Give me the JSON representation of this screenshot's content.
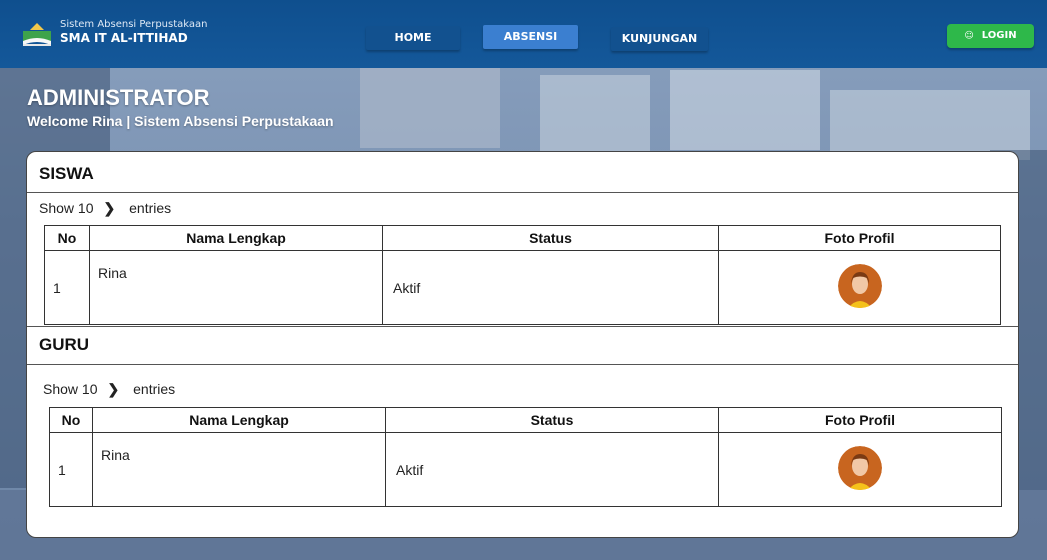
{
  "header": {
    "brand_sub": "Sistem Absensi Perpustakaan",
    "brand_main": "SMA IT AL-ITTIHAD",
    "nav": {
      "home": "HOME",
      "absensi": "ABSENSI",
      "kunjungan": "KUNJUNGAN"
    },
    "login": "LOGIN"
  },
  "page": {
    "title": "ADMINISTRATOR",
    "subtitle": "Welcome Rina | Sistem Absensi Perpustakaan"
  },
  "siswa": {
    "title": "SISWA",
    "show_label": "Show",
    "show_value": "10",
    "entries_label": "entries",
    "columns": [
      "No",
      "Nama Lengkap",
      "Status",
      "Foto Profil"
    ],
    "rows": [
      {
        "no": "1",
        "nama": "Rina",
        "status": "Aktif"
      }
    ]
  },
  "guru": {
    "title": "GURU",
    "show_label": "Show",
    "show_value": "10",
    "entries_label": "entries",
    "columns": [
      "No",
      "Nama Lengkap",
      "Status",
      "Foto Profil"
    ],
    "rows": [
      {
        "no": "1",
        "nama": "Rina",
        "status": "Aktif"
      }
    ]
  },
  "colors": {
    "header": "#14589a",
    "active_tab": "#3b7fd0",
    "login": "#2eb84a"
  }
}
